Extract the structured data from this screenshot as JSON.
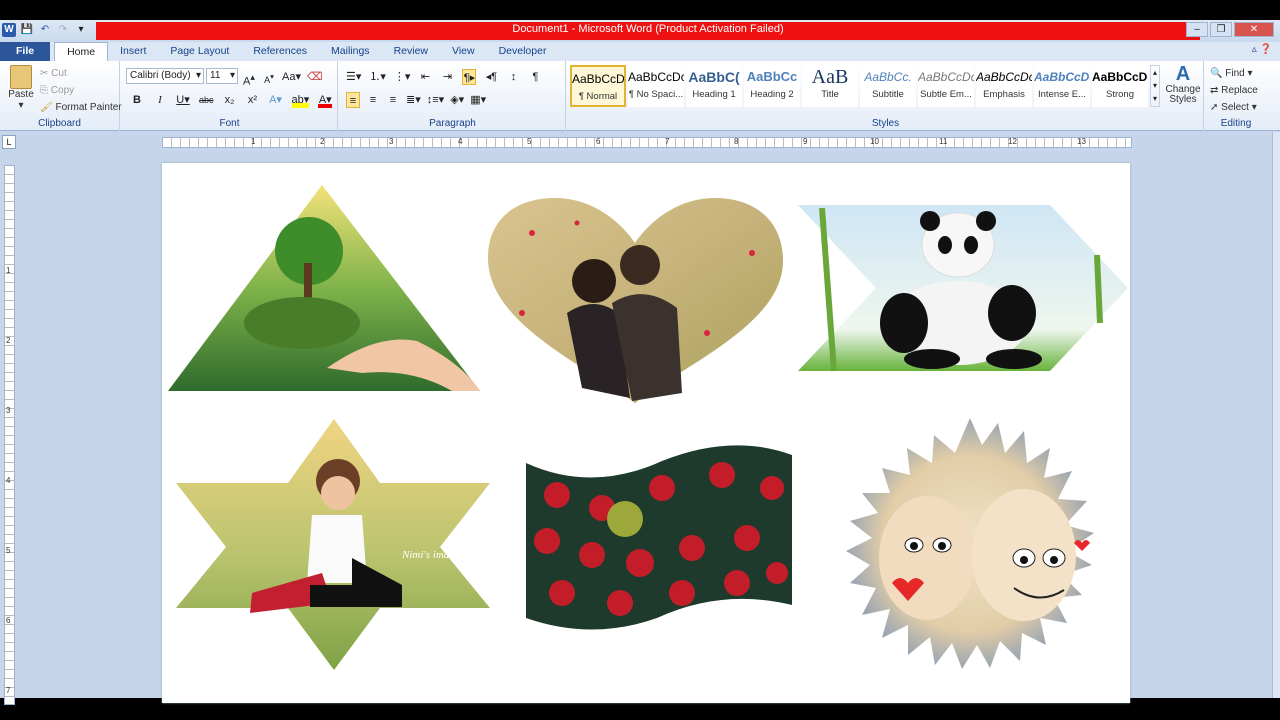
{
  "window": {
    "title": "Document1  -  Microsoft Word (Product Activation Failed)",
    "app_icon": "W"
  },
  "tabs": [
    {
      "label": "File"
    },
    {
      "label": "Home"
    },
    {
      "label": "Insert"
    },
    {
      "label": "Page Layout"
    },
    {
      "label": "References"
    },
    {
      "label": "Mailings"
    },
    {
      "label": "Review"
    },
    {
      "label": "View"
    },
    {
      "label": "Developer"
    }
  ],
  "clipboard": {
    "paste": "Paste",
    "cut": "Cut",
    "copy": "Copy",
    "format_painter": "Format Painter",
    "group_label": "Clipboard"
  },
  "font": {
    "name": "Calibri (Body)",
    "size": "11",
    "group_label": "Font"
  },
  "paragraph": {
    "group_label": "Paragraph"
  },
  "styles": {
    "items": [
      {
        "preview": "AaBbCcDc",
        "name": "¶ Normal"
      },
      {
        "preview": "AaBbCcDc",
        "name": "¶ No Spaci..."
      },
      {
        "preview": "AaBbC(",
        "name": "Heading 1"
      },
      {
        "preview": "AaBbCc",
        "name": "Heading 2"
      },
      {
        "preview": "AaB",
        "name": "Title"
      },
      {
        "preview": "AaBbCc.",
        "name": "Subtitle"
      },
      {
        "preview": "AaBbCcDc",
        "name": "Subtle Em..."
      },
      {
        "preview": "AaBbCcDc",
        "name": "Emphasis"
      },
      {
        "preview": "AaBbCcDc",
        "name": "Intense E..."
      },
      {
        "preview": "AaBbCcDc",
        "name": "Strong"
      }
    ],
    "change_styles": "Change Styles",
    "group_label": "Styles"
  },
  "editing": {
    "find": "Find",
    "replace": "Replace",
    "select": "Select",
    "group_label": "Editing"
  },
  "ruler_numbers": [
    "1",
    "2",
    "3",
    "4",
    "5",
    "6",
    "7",
    "8",
    "9",
    "10",
    "11",
    "12",
    "13"
  ],
  "vruler_numbers": [
    "1",
    "2",
    "3",
    "4",
    "5",
    "6",
    "7"
  ],
  "page": {
    "shapes": [
      {
        "shape": "triangle",
        "picture": "tree-in-hand"
      },
      {
        "shape": "heart",
        "picture": "couple-embrace"
      },
      {
        "shape": "chevron",
        "picture": "panda-eating-bamboo"
      },
      {
        "shape": "six-point-star",
        "picture": "child-playing-piano"
      },
      {
        "shape": "wave",
        "picture": "red-roses"
      },
      {
        "shape": "starburst",
        "picture": "cartoon-faces-hands"
      }
    ],
    "photo_watermark": "Nimi's ima"
  }
}
